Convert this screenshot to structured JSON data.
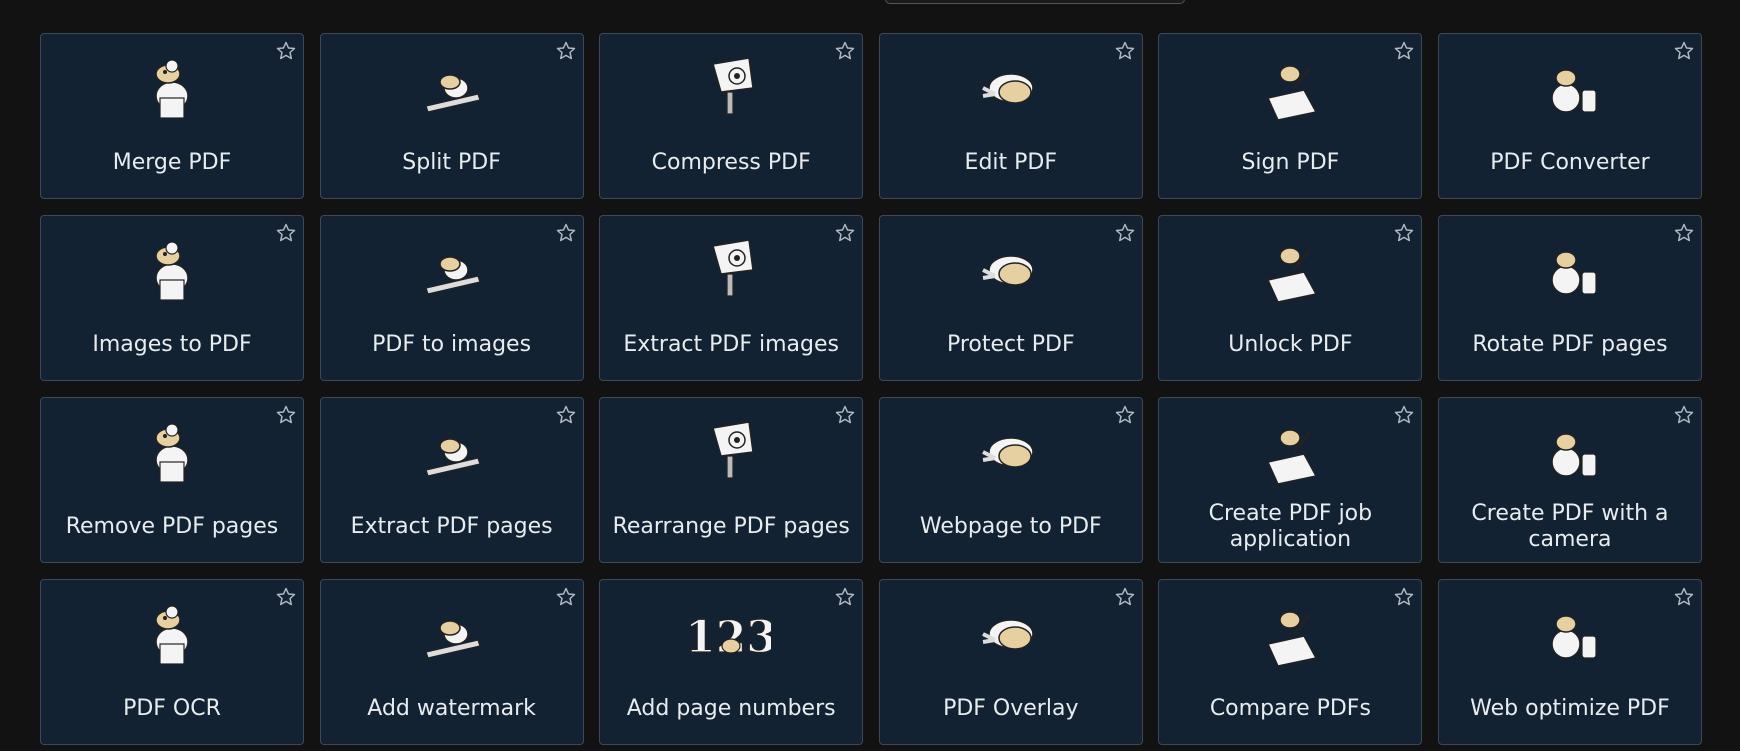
{
  "tools": [
    {
      "label": "Merge PDF",
      "icon": "merge-pdf-illustration-icon"
    },
    {
      "label": "Split PDF",
      "icon": "split-pdf-illustration-icon"
    },
    {
      "label": "Compress PDF",
      "icon": "compress-pdf-illustration-icon"
    },
    {
      "label": "Edit PDF",
      "icon": "edit-pdf-illustration-icon"
    },
    {
      "label": "Sign PDF",
      "icon": "sign-pdf-illustration-icon"
    },
    {
      "label": "PDF Converter",
      "icon": "pdf-converter-illustration-icon"
    },
    {
      "label": "Images to PDF",
      "icon": "images-to-pdf-illustration-icon"
    },
    {
      "label": "PDF to images",
      "icon": "pdf-to-images-illustration-icon"
    },
    {
      "label": "Extract PDF images",
      "icon": "extract-pdf-images-illustration-icon"
    },
    {
      "label": "Protect PDF",
      "icon": "protect-pdf-illustration-icon"
    },
    {
      "label": "Unlock PDF",
      "icon": "unlock-pdf-illustration-icon"
    },
    {
      "label": "Rotate PDF pages",
      "icon": "rotate-pdf-pages-illustration-icon"
    },
    {
      "label": "Remove PDF pages",
      "icon": "remove-pdf-pages-illustration-icon"
    },
    {
      "label": "Extract PDF pages",
      "icon": "extract-pdf-pages-illustration-icon"
    },
    {
      "label": "Rearrange PDF pages",
      "icon": "rearrange-pdf-pages-illustration-icon"
    },
    {
      "label": "Webpage to PDF",
      "icon": "webpage-to-pdf-illustration-icon"
    },
    {
      "label": "Create PDF job application",
      "icon": "create-pdf-job-application-illustration-icon"
    },
    {
      "label": "Create PDF with a camera",
      "icon": "create-pdf-with-camera-illustration-icon"
    },
    {
      "label": "PDF OCR",
      "icon": "pdf-ocr-illustration-icon"
    },
    {
      "label": "Add watermark",
      "icon": "add-watermark-illustration-icon"
    },
    {
      "label": "Add page numbers",
      "icon": "add-page-numbers-illustration-icon"
    },
    {
      "label": "PDF Overlay",
      "icon": "pdf-overlay-illustration-icon"
    },
    {
      "label": "Compare PDFs",
      "icon": "compare-pdfs-illustration-icon"
    },
    {
      "label": "Web optimize PDF",
      "icon": "web-optimize-pdf-illustration-icon"
    }
  ],
  "page_numbers_illustration_text": "123",
  "colors": {
    "background": "#121212",
    "card_background": "#122233",
    "card_border": "#3a4a58",
    "label_text": "#e8ecef",
    "star_outline": "#b0b8c0",
    "illustration_skin": "#e6cfa0",
    "illustration_white": "#f4f4f4"
  }
}
